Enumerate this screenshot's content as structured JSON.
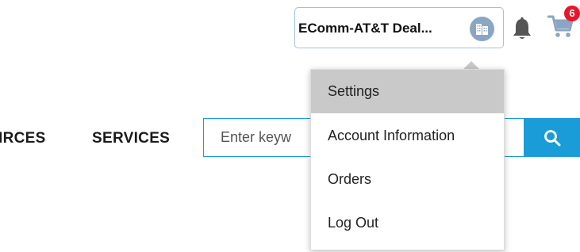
{
  "header": {
    "account_name": "EComm-AT&T Deal...",
    "cart_count": "6",
    "icons": {
      "account": "building-icon",
      "notifications": "bell-icon",
      "cart": "cart-icon"
    }
  },
  "nav": {
    "items": [
      "IRCES",
      "SERVICES"
    ]
  },
  "search": {
    "placeholder": "Enter keyw",
    "button_icon": "search-icon"
  },
  "account_menu": {
    "items": [
      "Settings",
      "Account Information",
      "Orders",
      "Log Out"
    ],
    "active_index": 0
  },
  "colors": {
    "accent": "#1a9cd8",
    "badge": "#e8162b",
    "menu_active": "#c9c9c9",
    "account_border": "#9fc3df"
  }
}
